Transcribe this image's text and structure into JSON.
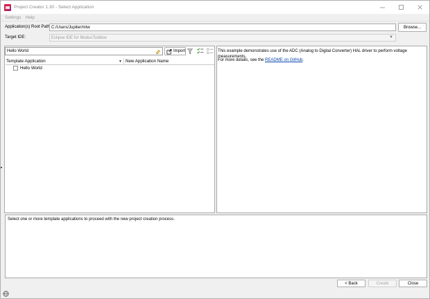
{
  "window": {
    "title": "Project Creator 1.30 - Select Application"
  },
  "menu": {
    "items": [
      "Settings",
      "Help"
    ]
  },
  "root_path": {
    "label": "Application(s) Root Path:",
    "value": "C:/Users/Jupiter/mtw",
    "browse_label": "Browse..."
  },
  "target_ide": {
    "label": "Target IDE:",
    "value": "Eclipse IDE for ModusToolbox"
  },
  "search": {
    "value": "Hello World"
  },
  "toolbar": {
    "import_label": "Import"
  },
  "table": {
    "columns": [
      "Template Application",
      "New Application Name"
    ],
    "rows": [
      {
        "name": "Hello World",
        "checked": false
      }
    ]
  },
  "description": {
    "text": "This example demonstrates use of the ADC (Analog to Digital Converter) HAL driver to perform voltage measurements.",
    "details_prefix": "For more details, see the ",
    "details_link": "README on GitHub",
    "details_suffix": "."
  },
  "status": {
    "text": "Select one or more template applications to proceed with the new project creation process."
  },
  "buttons": {
    "back": "< Back",
    "create": "Create",
    "close": "Close"
  },
  "icons": [
    "app-icon",
    "minimize-icon",
    "maximize-icon",
    "close-icon",
    "clear-text-icon",
    "import-icon",
    "filter-icon",
    "select-all-icon",
    "collapse-icon",
    "globe-icon"
  ]
}
